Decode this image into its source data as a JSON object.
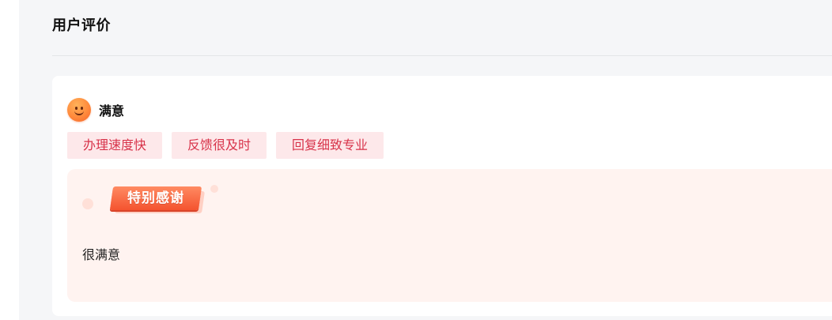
{
  "section": {
    "title": "用户评价"
  },
  "review": {
    "rating_icon": "smile-face-icon",
    "rating_label": "满意",
    "tags": [
      "办理速度快",
      "反馈很及时",
      "回复细致专业"
    ],
    "thanks_badge": "特别感谢",
    "comment": "很满意"
  },
  "colors": {
    "page_background": "#f5f6f8",
    "tag_background": "#fde8ea",
    "tag_text": "#d8334a",
    "thanks_background": "#fff3f0",
    "badge_gradient_top": "#ff8a62",
    "badge_gradient_bottom": "#f4532f",
    "smile_face": "#ff8a3c"
  }
}
